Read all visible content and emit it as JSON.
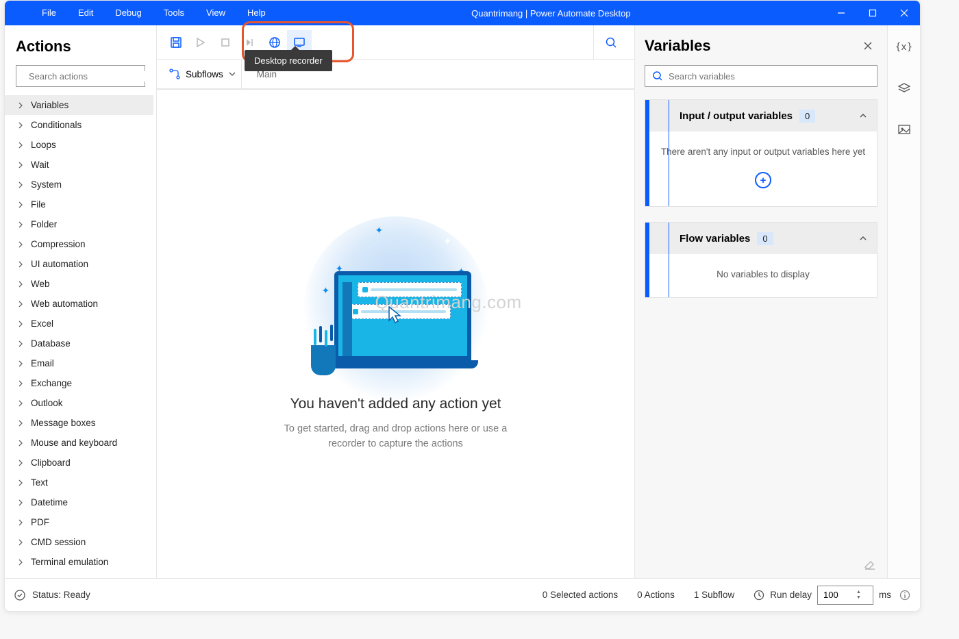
{
  "titlebar": {
    "menu": [
      "File",
      "Edit",
      "Debug",
      "Tools",
      "View",
      "Help"
    ],
    "title": "Quantrimang | Power Automate Desktop"
  },
  "left": {
    "title": "Actions",
    "search_placeholder": "Search actions",
    "items": [
      "Variables",
      "Conditionals",
      "Loops",
      "Wait",
      "System",
      "File",
      "Folder",
      "Compression",
      "UI automation",
      "Web",
      "Web automation",
      "Excel",
      "Database",
      "Email",
      "Exchange",
      "Outlook",
      "Message boxes",
      "Mouse and keyboard",
      "Clipboard",
      "Text",
      "Datetime",
      "PDF",
      "CMD session",
      "Terminal emulation"
    ],
    "selected_index": 0
  },
  "center": {
    "tooltip": "Desktop recorder",
    "subflows_label": "Subflows",
    "main_tab": "Main",
    "empty_title": "You haven't added any action yet",
    "empty_sub": "To get started, drag and drop actions here or use a recorder to capture the actions",
    "watermark": "Quantrimang.com"
  },
  "right": {
    "title": "Variables",
    "search_placeholder": "Search variables",
    "cards": [
      {
        "title": "Input / output variables",
        "count": "0",
        "body": "There aren't any input or output variables here yet",
        "has_add": true
      },
      {
        "title": "Flow variables",
        "count": "0",
        "body": "No variables to display",
        "has_add": false
      }
    ]
  },
  "status": {
    "ready": "Status: Ready",
    "selected": "0 Selected actions",
    "actions": "0 Actions",
    "subflow": "1 Subflow",
    "delay_label": "Run delay",
    "delay_value": "100",
    "delay_unit": "ms"
  }
}
